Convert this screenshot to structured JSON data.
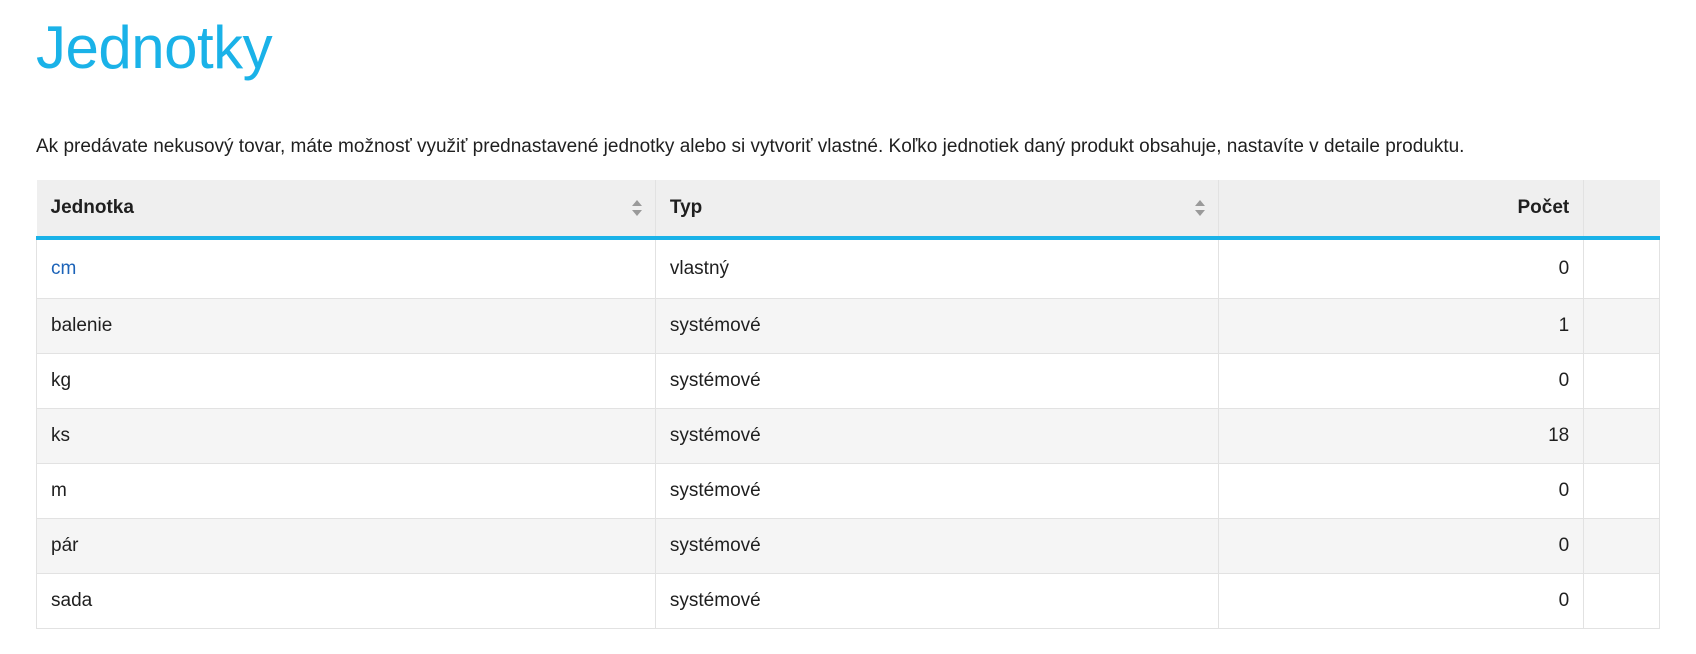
{
  "page": {
    "title": "Jednotky",
    "description": "Ak predávate nekusový tovar, máte možnosť využiť prednastavené jednotky alebo si vytvoriť vlastné. Koľko jednotiek daný produkt obsahuje, nastavíte v detaile produktu."
  },
  "table": {
    "columns": {
      "unit": "Jednotka",
      "type": "Typ",
      "count": "Počet"
    },
    "rows": [
      {
        "unit": "cm",
        "type": "vlastný",
        "count": "0",
        "link": true
      },
      {
        "unit": "balenie",
        "type": "systémové",
        "count": "1"
      },
      {
        "unit": "kg",
        "type": "systémové",
        "count": "0"
      },
      {
        "unit": "ks",
        "type": "systémové",
        "count": "18"
      },
      {
        "unit": "m",
        "type": "systémové",
        "count": "0"
      },
      {
        "unit": "pár",
        "type": "systémové",
        "count": "0"
      },
      {
        "unit": "sada",
        "type": "systémové",
        "count": "0"
      }
    ]
  },
  "colors": {
    "accent": "#1ab2e8",
    "link": "#1c63b8",
    "header_bg": "#efefef"
  },
  "icons": {
    "sort": "sort-icon"
  }
}
